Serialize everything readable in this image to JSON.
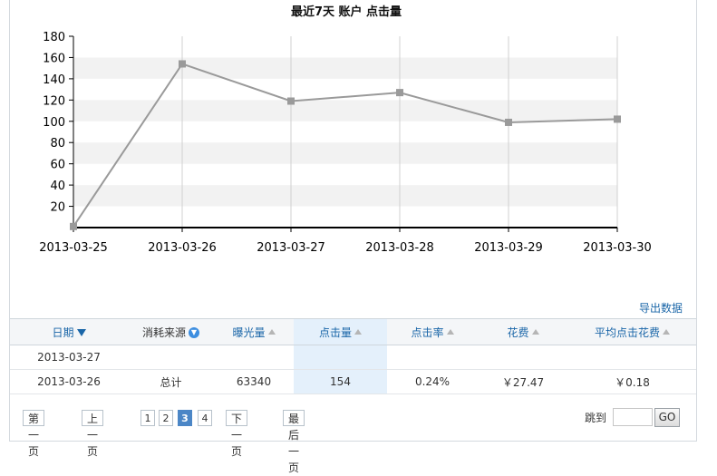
{
  "chart_data": {
    "type": "line",
    "title": "最近7天 账户 点击量",
    "categories": [
      "2013-03-25",
      "2013-03-26",
      "2013-03-27",
      "2013-03-28",
      "2013-03-29",
      "2013-03-30"
    ],
    "yticks": [
      "20",
      "40",
      "60",
      "80",
      "100",
      "120",
      "140",
      "160",
      "180"
    ],
    "series": [
      {
        "values": [
          1,
          154,
          119,
          127,
          99,
          102
        ]
      }
    ],
    "ylim": [
      0,
      180
    ],
    "grid": "alternating horizontal bands",
    "line_color": "#9a9a9a"
  },
  "export_label": "导出数据",
  "table": {
    "headers": {
      "date": "日期",
      "source": "消耗来源",
      "impressions": "曝光量",
      "clicks": "点击量",
      "ctr": "点击率",
      "cost": "花费",
      "avg_cpc": "平均点击花费"
    },
    "rows": [
      {
        "date": "2013-03-27",
        "source": "",
        "impressions": "",
        "clicks": "",
        "ctr": "",
        "cost": "",
        "avg_cpc": ""
      },
      {
        "date": "2013-03-26",
        "source": "总计",
        "impressions": "63340",
        "clicks": "154",
        "ctr": "0.24%",
        "cost": "￥27.47",
        "avg_cpc": "￥0.18"
      }
    ]
  },
  "pager": {
    "first": "第一页",
    "prev": "上一页",
    "pages": [
      "1",
      "2",
      "3",
      "4"
    ],
    "current": "3",
    "next": "下一页",
    "last": "最后一页",
    "jump_label": "跳到",
    "jump_value": "",
    "go": "GO"
  },
  "colors": {
    "link": "#1a66a8",
    "highlight_col": "#e4f0fb",
    "active_page": "#4b86c6"
  }
}
